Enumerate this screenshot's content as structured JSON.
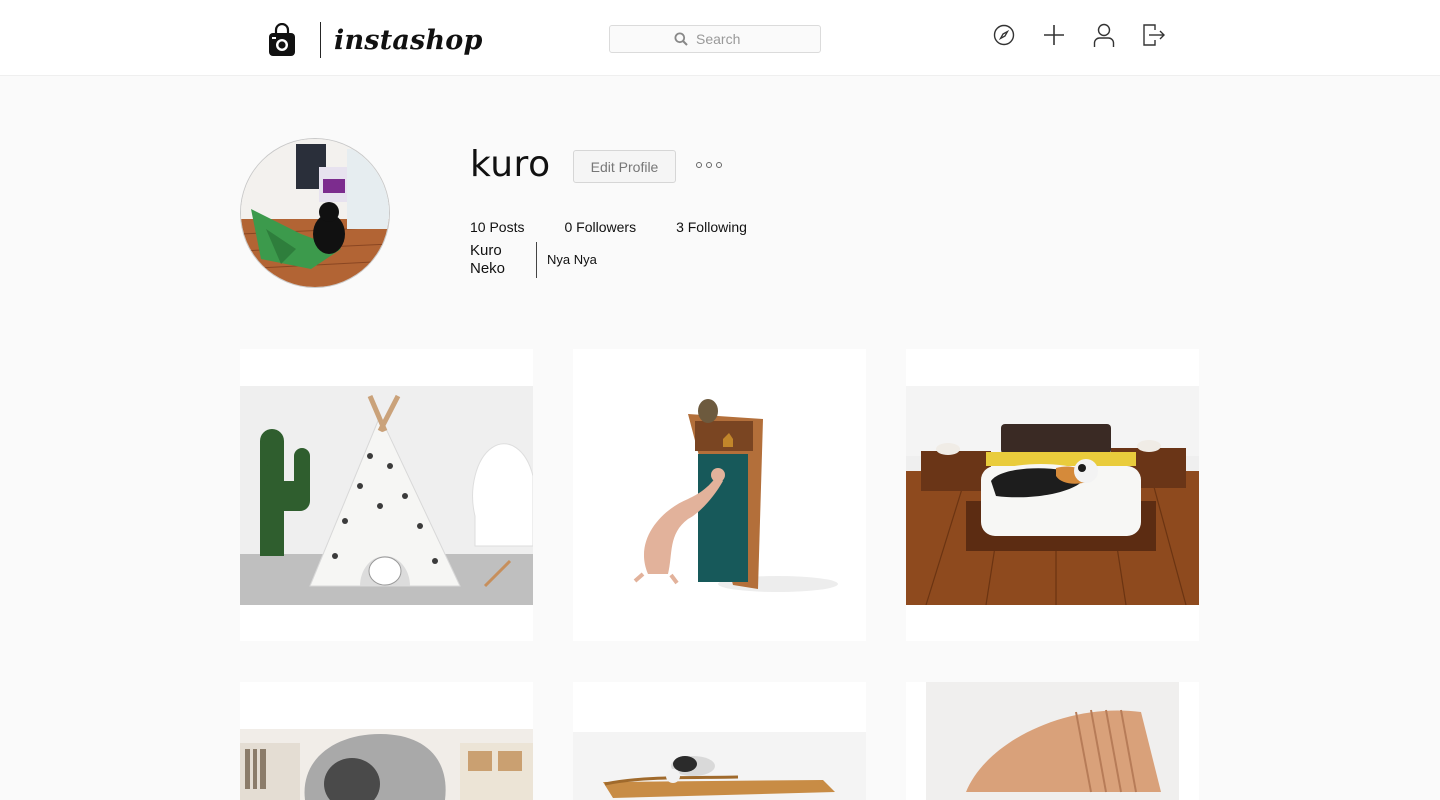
{
  "app": {
    "brand": "instashop"
  },
  "header": {
    "search_placeholder": "Search",
    "nav": [
      "compass-icon",
      "plus-icon",
      "user-icon",
      "logout-icon"
    ]
  },
  "profile": {
    "username": "kuro",
    "edit_label": "Edit Profile",
    "stats": {
      "posts": "10 Posts",
      "followers": "0 Followers",
      "following": "3 Following"
    },
    "full_name": "Kuro Neko",
    "bio": "Nya Nya"
  },
  "colors": {
    "accent": "#262626",
    "background": "#fafafa",
    "card": "#ffffff"
  }
}
